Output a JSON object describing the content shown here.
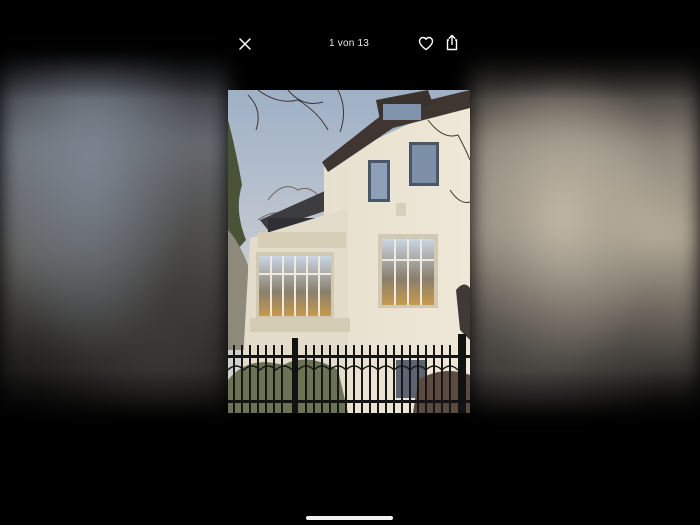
{
  "viewer": {
    "counter_text": "1 von 13"
  },
  "icons": {
    "close": "close-icon",
    "like": "heart-icon",
    "share": "share-icon"
  },
  "colors": {
    "background": "#000000",
    "icon": "#ffffff",
    "home_indicator": "#f2f2f2"
  }
}
